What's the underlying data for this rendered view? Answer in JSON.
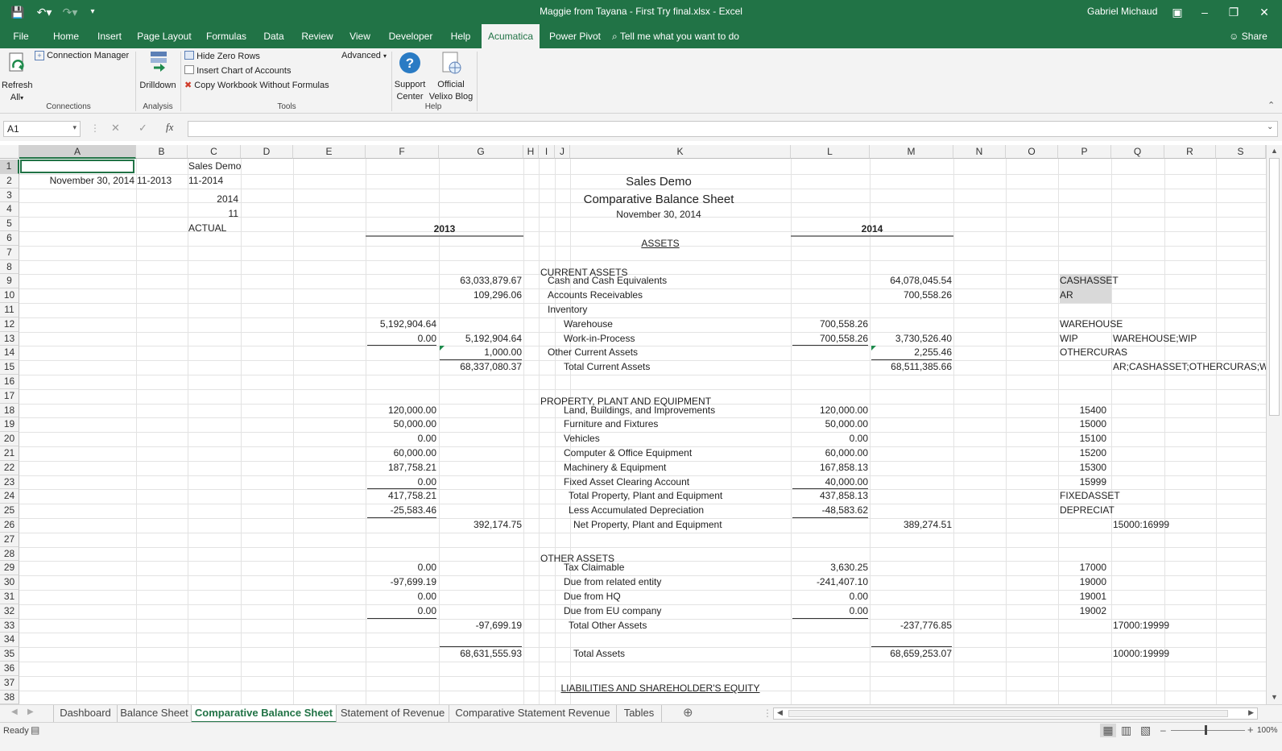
{
  "app": {
    "window_title": "Maggie from Tayana - First Try final.xlsx  -  Excel",
    "user_name": "Gabriel Michaud"
  },
  "ribbon_tabs": [
    "File",
    "Home",
    "Insert",
    "Page Layout",
    "Formulas",
    "Data",
    "Review",
    "View",
    "Developer",
    "Help",
    "Acumatica",
    "Power Pivot"
  ],
  "active_tab": "Acumatica",
  "tell_me": "Tell me what you want to do",
  "share_label": "Share",
  "ribbon": {
    "refresh_label": "Refresh",
    "refresh_all_label": "All",
    "connection_manager": "Connection Manager",
    "connections_group": "Connections",
    "drilldown": "Drilldown",
    "analysis_group": "Analysis",
    "hide_zero_rows": "Hide Zero Rows",
    "insert_chart_of_accounts": "Insert Chart of Accounts",
    "copy_workbook": "Copy Workbook Without Formulas",
    "advanced": "Advanced",
    "tools_group": "Tools",
    "support_center_1": "Support",
    "support_center_2": "Center",
    "official_blog_1": "Official",
    "official_blog_2": "Velixo Blog",
    "help_group": "Help"
  },
  "formula_bar": {
    "name_box": "A1",
    "fx": "fx",
    "formula": ""
  },
  "columns": [
    "A",
    "B",
    "C",
    "D",
    "E",
    "F",
    "G",
    "H",
    "I",
    "J",
    "K",
    "L",
    "M",
    "N",
    "O",
    "P",
    "Q",
    "R",
    "S"
  ],
  "rows": [
    "1",
    "2",
    "3",
    "4",
    "5",
    "6",
    "7",
    "8",
    "9",
    "10",
    "11",
    "12",
    "13",
    "14",
    "15",
    "16",
    "17",
    "18",
    "19",
    "20",
    "21",
    "22",
    "23",
    "24",
    "25",
    "26",
    "27",
    "28",
    "29",
    "30",
    "31",
    "32",
    "33",
    "34",
    "35",
    "36",
    "37",
    "38"
  ],
  "sheet": {
    "a2": "November 30, 2014",
    "b2": "11-2013",
    "c1": "Sales Demo",
    "c2": "11-2014",
    "c3": "2014",
    "c4": "11",
    "c5": "ACTUAL",
    "title1": "Sales Demo",
    "title2": "Comparative Balance Sheet",
    "title3": "November 30, 2014",
    "hdr_2013": "2013",
    "hdr_2014": "2014",
    "assets": "ASSETS",
    "current_assets": "CURRENT ASSETS",
    "ppe": "PROPERTY, PLANT AND EQUIPMENT",
    "other_assets": "OTHER ASSETS",
    "liabilities": "LIABILITIES AND SHAREHOLDER'S EQUITY"
  },
  "lines": [
    {
      "row": 9,
      "label": "Cash and Cash Equivalents",
      "indent": 1,
      "f": "",
      "g": "63,033,879.67",
      "l": "",
      "m": "64,078,045.54",
      "p": "CASHASSET",
      "q": ""
    },
    {
      "row": 10,
      "label": "Accounts Receivables",
      "indent": 1,
      "f": "",
      "g": "109,296.06",
      "l": "",
      "m": "700,558.26",
      "p": "AR",
      "q": ""
    },
    {
      "row": 11,
      "label": "Inventory",
      "indent": 1,
      "f": "",
      "g": "",
      "l": "",
      "m": "",
      "p": "",
      "q": ""
    },
    {
      "row": 12,
      "label": "Warehouse",
      "indent": 2,
      "f": "5,192,904.64",
      "g": "",
      "l": "700,558.26",
      "m": "",
      "p": "WAREHOUSE",
      "q": ""
    },
    {
      "row": 13,
      "label": "Work-in-Process",
      "indent": 2,
      "f": "0.00",
      "g": "5,192,904.64",
      "l": "700,558.26",
      "m": "3,730,526.40",
      "p": "WIP",
      "q": "WAREHOUSE;WIP"
    },
    {
      "row": 14,
      "label": "Other Current Assets",
      "indent": 1,
      "f": "",
      "g": "1,000.00",
      "l": "",
      "m": "2,255.46",
      "p": "OTHERCURAS",
      "q": ""
    },
    {
      "row": 15,
      "label": "Total Current Assets",
      "indent": 2,
      "f": "",
      "g": "68,337,080.37",
      "l": "",
      "m": "68,511,385.66",
      "p": "",
      "q": "AR;CASHASSET;OTHERCURAS;WAI"
    },
    {
      "row": 18,
      "label": "Land, Buildings, and Improvements",
      "indent": 2,
      "f": "120,000.00",
      "g": "",
      "l": "120,000.00",
      "m": "",
      "p": "15400",
      "q": ""
    },
    {
      "row": 19,
      "label": "Furniture and Fixtures",
      "indent": 2,
      "f": "50,000.00",
      "g": "",
      "l": "50,000.00",
      "m": "",
      "p": "15000",
      "q": ""
    },
    {
      "row": 20,
      "label": "Vehicles",
      "indent": 2,
      "f": "0.00",
      "g": "",
      "l": "0.00",
      "m": "",
      "p": "15100",
      "q": ""
    },
    {
      "row": 21,
      "label": "Computer & Office Equipment",
      "indent": 2,
      "f": "60,000.00",
      "g": "",
      "l": "60,000.00",
      "m": "",
      "p": "15200",
      "q": ""
    },
    {
      "row": 22,
      "label": "Machinery & Equipment",
      "indent": 2,
      "f": "187,758.21",
      "g": "",
      "l": "167,858.13",
      "m": "",
      "p": "15300",
      "q": ""
    },
    {
      "row": 23,
      "label": "Fixed Asset Clearing Account",
      "indent": 2,
      "f": "0.00",
      "g": "",
      "l": "40,000.00",
      "m": "",
      "p": "15999",
      "q": ""
    },
    {
      "row": 24,
      "label": "Total Property, Plant and Equipment",
      "indent": 3,
      "f": "417,758.21",
      "g": "",
      "l": "437,858.13",
      "m": "",
      "p": "FIXEDASSET",
      "q": ""
    },
    {
      "row": 25,
      "label": "Less Accumulated Depreciation",
      "indent": 3,
      "f": "-25,583.46",
      "g": "",
      "l": "-48,583.62",
      "m": "",
      "p": "DEPRECIAT",
      "q": ""
    },
    {
      "row": 26,
      "label": "Net Property, Plant and Equipment",
      "indent": 4,
      "f": "",
      "g": "392,174.75",
      "l": "",
      "m": "389,274.51",
      "p": "",
      "q": "15000:16999"
    },
    {
      "row": 29,
      "label": "Tax Claimable",
      "indent": 2,
      "f": "0.00",
      "g": "",
      "l": "3,630.25",
      "m": "",
      "p": "17000",
      "q": ""
    },
    {
      "row": 30,
      "label": "Due from related entity",
      "indent": 2,
      "f": "-97,699.19",
      "g": "",
      "l": "-241,407.10",
      "m": "",
      "p": "19000",
      "q": ""
    },
    {
      "row": 31,
      "label": "Due from HQ",
      "indent": 2,
      "f": "0.00",
      "g": "",
      "l": "0.00",
      "m": "",
      "p": "19001",
      "q": ""
    },
    {
      "row": 32,
      "label": "Due from EU company",
      "indent": 2,
      "f": "0.00",
      "g": "",
      "l": "0.00",
      "m": "",
      "p": "19002",
      "q": ""
    },
    {
      "row": 33,
      "label": "Total Other Assets",
      "indent": 3,
      "f": "",
      "g": "-97,699.19",
      "l": "",
      "m": "-237,776.85",
      "p": "",
      "q": "17000:19999"
    },
    {
      "row": 35,
      "label": "Total Assets",
      "indent": 4,
      "f": "",
      "g": "68,631,555.93",
      "l": "",
      "m": "68,659,253.07",
      "p": "",
      "q": "10000:19999"
    }
  ],
  "sheet_tabs": [
    "Dashboard",
    "Balance Sheet",
    "Comparative Balance Sheet",
    "Statement of Revenue",
    "Comparative Statement Revenue",
    "Tables"
  ],
  "active_sheet": "Comparative Balance Sheet",
  "status": {
    "ready": "Ready",
    "zoom": "100%"
  }
}
